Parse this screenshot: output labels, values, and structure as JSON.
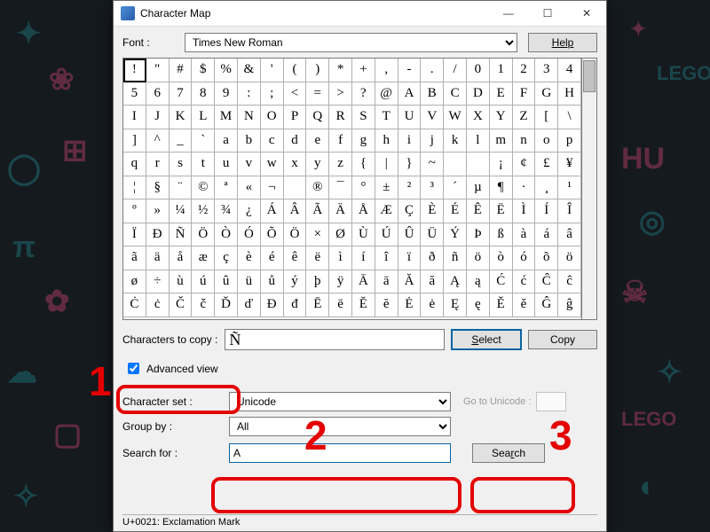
{
  "window": {
    "title": "Character Map",
    "controls": {
      "min": "—",
      "max": "☐",
      "close": "✕"
    }
  },
  "font_row": {
    "label": "Font :",
    "value": "Times New Roman",
    "help": "Help"
  },
  "char_grid": {
    "selected_index": 0,
    "chars": [
      "!",
      "\"",
      "#",
      "$",
      "%",
      "&",
      "'",
      "(",
      ")",
      "*",
      "+",
      ",",
      "-",
      ".",
      "/",
      "0",
      "1",
      "2",
      "3",
      "4",
      "5",
      "6",
      "7",
      "8",
      "9",
      ":",
      ";",
      "<",
      "=",
      ">",
      "?",
      "@",
      "A",
      "B",
      "C",
      "D",
      "E",
      "F",
      "G",
      "H",
      "I",
      "J",
      "K",
      "L",
      "M",
      "N",
      "O",
      "P",
      "Q",
      "R",
      "S",
      "T",
      "U",
      "V",
      "W",
      "X",
      "Y",
      "Z",
      "[",
      "\\",
      "]",
      "^",
      "_",
      "`",
      "a",
      "b",
      "c",
      "d",
      "e",
      "f",
      "g",
      "h",
      "i",
      "j",
      "k",
      "l",
      "m",
      "n",
      "o",
      "p",
      "q",
      "r",
      "s",
      "t",
      "u",
      "v",
      "w",
      "x",
      "y",
      "z",
      "{",
      "|",
      "}",
      "~",
      " ",
      " ",
      "¡",
      "¢",
      "£",
      "¥",
      "¦",
      "§",
      "¨",
      "©",
      "ª",
      "«",
      "¬",
      "­",
      "®",
      "¯",
      "°",
      "±",
      "²",
      "³",
      "´",
      "µ",
      "¶",
      "·",
      "¸",
      "¹",
      "º",
      "»",
      "¼",
      "½",
      "¾",
      "¿",
      "Á",
      "Â",
      "Ã",
      "Ä",
      "Å",
      "Æ",
      "Ç",
      "È",
      "É",
      "Ê",
      "Ë",
      "Ì",
      "Í",
      "Î",
      "Ï",
      "Ð",
      "Ñ",
      "Ö",
      "Ò",
      "Ó",
      "Õ",
      "Ö",
      "×",
      "Ø",
      "Ù",
      "Ú",
      "Û",
      "Ü",
      "Ý",
      "Þ",
      "ß",
      "à",
      "á",
      "â",
      "ã",
      "ä",
      "å",
      "æ",
      "ç",
      "è",
      "é",
      "ê",
      "ë",
      "ì",
      "í",
      "î",
      "ï",
      "ð",
      "ñ",
      "ö",
      "ò",
      "ó",
      "õ",
      "ö",
      "ø",
      "÷",
      "ù",
      "ú",
      "û",
      "ü",
      "ů",
      "ý",
      "þ",
      "ÿ",
      "Ā",
      "ā",
      "Ă",
      "ă",
      "Ą",
      "ą",
      "Ć",
      "ć",
      "Ĉ",
      "ĉ",
      "Ċ",
      "ċ",
      "Č",
      "č",
      "Ď",
      "ď",
      "Đ",
      "đ",
      "Ē",
      "ē",
      "Ĕ",
      "ĕ",
      "Ė",
      "ė",
      "Ę",
      "ę",
      "Ě",
      "ě",
      "Ĝ",
      "ĝ"
    ]
  },
  "copy_row": {
    "label": "Characters to copy :",
    "value": "Ñ",
    "select": "Select",
    "copy": "Copy"
  },
  "advanced": {
    "checkbox": "Advanced view",
    "checked": true,
    "charset_label": "Character set :",
    "charset_value": "Unicode",
    "groupby_label": "Group by :",
    "groupby_value": "All",
    "go_label": "Go to Unicode :",
    "search_label": "Search for :",
    "search_value": "A",
    "search_btn": "Search"
  },
  "status": "U+0021: Exclamation Mark",
  "annotations": {
    "n1": "1",
    "n2": "2",
    "n3": "3"
  }
}
